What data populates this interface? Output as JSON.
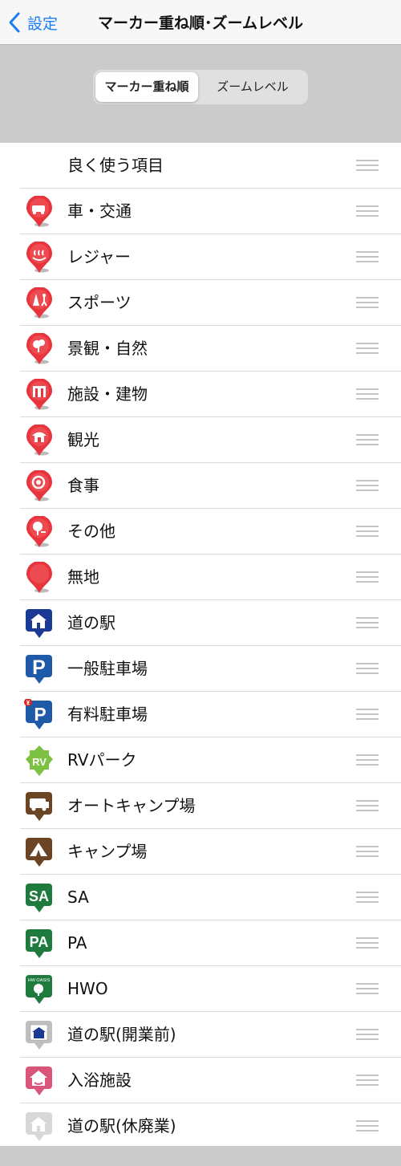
{
  "nav": {
    "back_label": "設定",
    "title": "マーカー重ね順･ズームレベル"
  },
  "segment": {
    "selected": "マーカー重ね順",
    "other": "ズームレベル"
  },
  "rows": [
    {
      "label": "良く使う項目",
      "icon": "none"
    },
    {
      "label": "車・交通",
      "icon": "car-pin-icon"
    },
    {
      "label": "レジャー",
      "icon": "hot-spring-pin-icon"
    },
    {
      "label": "スポーツ",
      "icon": "sports-pin-icon"
    },
    {
      "label": "景観・自然",
      "icon": "scenery-pin-icon"
    },
    {
      "label": "施設・建物",
      "icon": "facility-pin-icon"
    },
    {
      "label": "観光",
      "icon": "sightseeing-pin-icon"
    },
    {
      "label": "食事",
      "icon": "meal-pin-icon"
    },
    {
      "label": "その他",
      "icon": "other-pin-icon"
    },
    {
      "label": "無地",
      "icon": "plain-pin-icon"
    },
    {
      "label": "道の駅",
      "icon": "roadside-station-icon"
    },
    {
      "label": "一般駐車場",
      "icon": "parking-icon"
    },
    {
      "label": "有料駐車場",
      "icon": "paid-parking-icon"
    },
    {
      "label": "RVパーク",
      "icon": "rv-park-icon"
    },
    {
      "label": "オートキャンプ場",
      "icon": "auto-camp-icon"
    },
    {
      "label": "キャンプ場",
      "icon": "camp-icon"
    },
    {
      "label": "SA",
      "icon": "sa-icon"
    },
    {
      "label": "PA",
      "icon": "pa-icon"
    },
    {
      "label": "HWO",
      "icon": "hwo-icon"
    },
    {
      "label": "道の駅(開業前)",
      "icon": "roadside-station-preopen-icon"
    },
    {
      "label": "入浴施設",
      "icon": "bath-facility-icon"
    },
    {
      "label": "道の駅(休廃業)",
      "icon": "roadside-station-closed-icon"
    }
  ],
  "icon_text": {
    "sa": "SA",
    "pa": "PA",
    "p": "P",
    "yen": "¥",
    "rv": "RV",
    "hw": "HW OASIS"
  },
  "colors": {
    "accent": "#1a7cf5",
    "red_pin": "#e8343c",
    "navy": "#1a3a93",
    "green": "#1f7a3d",
    "rv_green": "#7cc142",
    "brown": "#6b4423",
    "pink": "#d9557a",
    "gray": "#bfbfbf"
  }
}
